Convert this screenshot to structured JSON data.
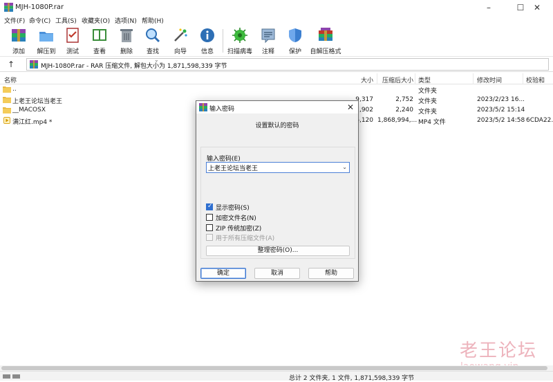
{
  "window": {
    "title": "MJH-1080P.rar"
  },
  "menu": [
    "文件(F)",
    "命令(C)",
    "工具(S)",
    "收藏夹(O)",
    "选项(N)",
    "帮助(H)"
  ],
  "toolbar": {
    "add": "添加",
    "extract": "解压到",
    "test": "测试",
    "view": "查看",
    "delete": "删除",
    "find": "查找",
    "wizard": "向导",
    "info": "信息",
    "virus_scan": "扫描病毒",
    "comment": "注释",
    "protect": "保护",
    "sfx": "自解压格式"
  },
  "address": {
    "text": "MJH-1080P.rar - RAR 压缩文件, 解包大小为 1,871,598,339 字节"
  },
  "columns": {
    "name": "名称",
    "size": "大小",
    "packed": "压缩后大小",
    "type": "类型",
    "modified": "修改时间",
    "crc": "校验和"
  },
  "files": [
    {
      "name": "..",
      "size": "",
      "packed": "",
      "type": "文件夹",
      "modified": "",
      "crc": ""
    },
    {
      "name": "上老王论坛当老王",
      "size": "9,317",
      "packed": "2,752",
      "type": "文件夹",
      "modified": "2023/2/23 16...",
      "crc": ""
    },
    {
      "name": "__MACOSX",
      "size": "2,902",
      "packed": "2,240",
      "type": "文件夹",
      "modified": "2023/5/2 15:14",
      "crc": ""
    },
    {
      "name": "满江红.mp4 *",
      "size": "6,120",
      "packed": "1,868,994,...",
      "type": "MP4 文件",
      "modified": "2023/5/2 14:58",
      "crc": "6CDA22..."
    }
  ],
  "status": {
    "text": "总计 2 文件夹, 1 文件, 1,871,598,339 字节"
  },
  "watermark": {
    "main": "老王论坛",
    "url": "laowang.vip"
  },
  "dialog": {
    "title": "输入密码",
    "subtitle": "设置默认的密码",
    "pw_label": "输入密码(E)",
    "pw_value": "上老王论坛当老王",
    "show_password": "显示密码(S)",
    "encrypt_names": "加密文件名(N)",
    "zip_legacy": "ZIP 传统加密(Z)",
    "use_all": "用于所有压缩文件(A)",
    "organize": "整理密码(O)...",
    "ok": "确定",
    "cancel": "取消",
    "help": "帮助"
  }
}
